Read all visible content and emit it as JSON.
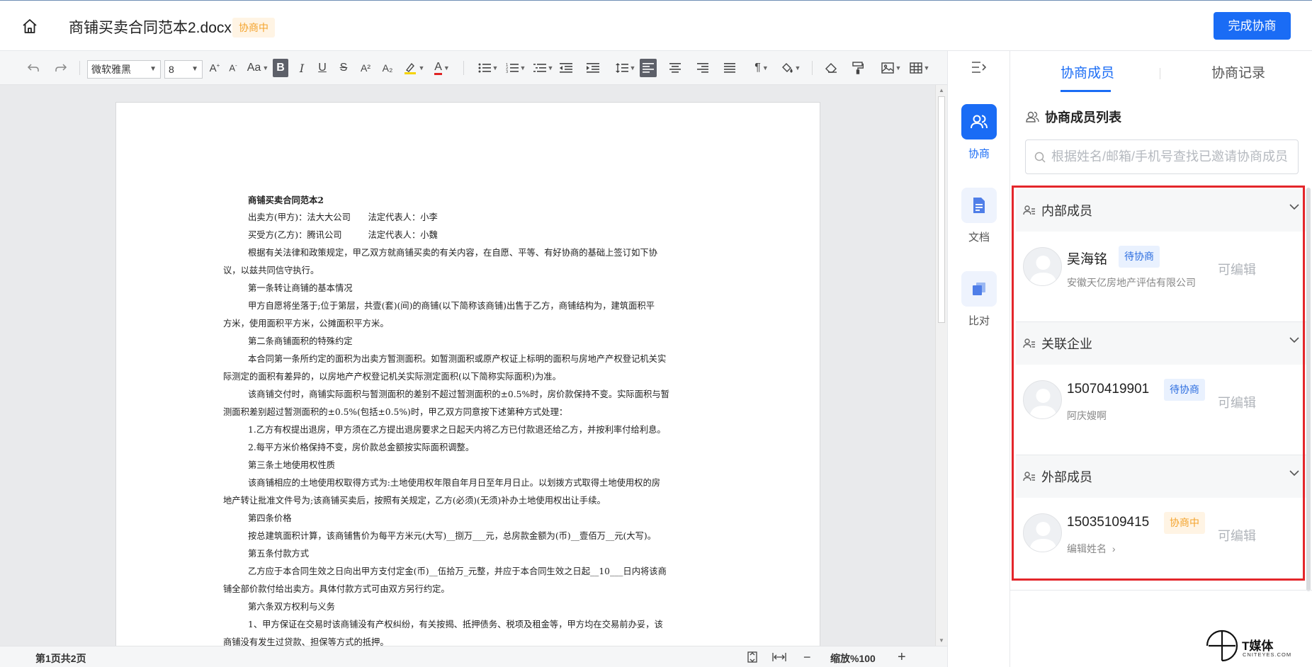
{
  "header": {
    "doc_title": "商铺买卖合同范本2.docx",
    "status_badge": "协商中",
    "finish_button": "完成协商"
  },
  "toolbar": {
    "font_family": "微软雅黑",
    "font_size": "8",
    "case_label": "Aa",
    "bold_label": "B",
    "italic_label": "I",
    "underline_label": "U",
    "strike_label": "S",
    "superscript_label": "A²",
    "subscript_label": "A₂",
    "font_color_label": "A",
    "paragraph_label": "¶",
    "highlight_color": "#f5d300",
    "font_color": "#e02424"
  },
  "document": {
    "title": "商铺买卖合同范本2",
    "lines": [
      "出卖方(甲方)：法大大公司　　法定代表人：小李",
      "买受方(乙方)：腾讯公司　　　法定代表人：小魏",
      "根据有关法律和政策规定，甲乙双方就商铺买卖的有关内容，在自愿、平等、有好协商的基础上签订如下协",
      "议，以兹共同信守执行。",
      "第一条转让商铺的基本情况",
      "甲方自愿将坐落于;位于第层，共壹(套)(间)的商铺(以下简称该商铺)出售于乙方，商铺结构为，建筑面积平",
      "方米，使用面积平方米，公摊面积平方米。",
      "第二条商铺面积的特殊约定",
      "本合同第一条所约定的面积为出卖方暂测面积。如暂测面积或原产权证上标明的面积与房地产产权登记机关实",
      "际测定的面积有差异的，以房地产产权登记机关实际测定面积(以下简称实际面积)为准。",
      "该商铺交付时，商铺实际面积与暂测面积的差别不超过暂测面积的±0.5%时，房价款保持不变。实际面积与暂",
      "测面积差别超过暂测面积的±0.5%(包括±0.5%)时，甲乙双方同意按下述第种方式处理：",
      "1.乙方有权提出退房，甲方须在乙方提出退房要求之日起天内将乙方已付款退还给乙方，并按利率付给利息。",
      "2.每平方米价格保持不变，房价款总金额按实际面积调整。",
      "第三条土地使用权性质",
      "该商铺相应的土地使用权取得方式为:土地使用权年限自年月日至年月日止。以划拨方式取得土地使用权的房",
      "地产转让批准文件号为;该商铺买卖后，按照有关规定，乙方(必须)(无须)补办土地使用权出让手续。",
      "第四条价格",
      "按总建筑面积计算，该商铺售价为每平方米元(大写)__捌万___元，总房款金额为(币)__壹佰万__元(大写)。",
      "第五条付款方式",
      "乙方应于本合同生效之日向出甲方支付定金(币)__伍拾万_元整，并应于本合同生效之日起__10___日内将该商",
      "铺全部价款付给出卖方。具体付款方式可由双方另行约定。",
      "第六条双方权利与义务",
      "1、甲方保证在交易时该商铺没有产权纠纷，有关按揭、抵押债务、税项及租金等，甲方均在交易前办妥，该",
      "商铺没有发生过贷款、担保等方式的抵押。"
    ]
  },
  "statusbar": {
    "page_info": "第1页共2页",
    "zoom_label": "缩放%100"
  },
  "rail": {
    "items": [
      {
        "label": "协商",
        "icon": "users-icon"
      },
      {
        "label": "文档",
        "icon": "document-icon"
      },
      {
        "label": "比对",
        "icon": "compare-icon"
      }
    ]
  },
  "panel": {
    "tabs": [
      "协商成员",
      "协商记录"
    ],
    "list_title": "协商成员列表",
    "search_placeholder": "根据姓名/邮箱/手机号查找已邀请协商成员",
    "groups": [
      {
        "name": "内部成员",
        "member": {
          "name": "吴海铭",
          "badge": "待协商",
          "sub": "安徽天亿房地产评估有限公司",
          "perm": "可编辑"
        }
      },
      {
        "name": "关联企业",
        "member": {
          "name": "15070419901",
          "badge": "待协商",
          "sub": "阿庆嫂啊",
          "perm": "可编辑"
        }
      },
      {
        "name": "外部成员",
        "member": {
          "name": "15035109415",
          "badge": "协商中",
          "sub": "编辑姓名",
          "perm": "可编辑"
        }
      }
    ]
  },
  "watermark": {
    "title": "T媒体",
    "sub": "CNITEYES.COM"
  },
  "colors": {
    "accent": "#1a6cf5",
    "highlight_border": "#e4262b",
    "pending_badge": "#2b6de0",
    "negotiating_badge": "#f4a32c"
  }
}
